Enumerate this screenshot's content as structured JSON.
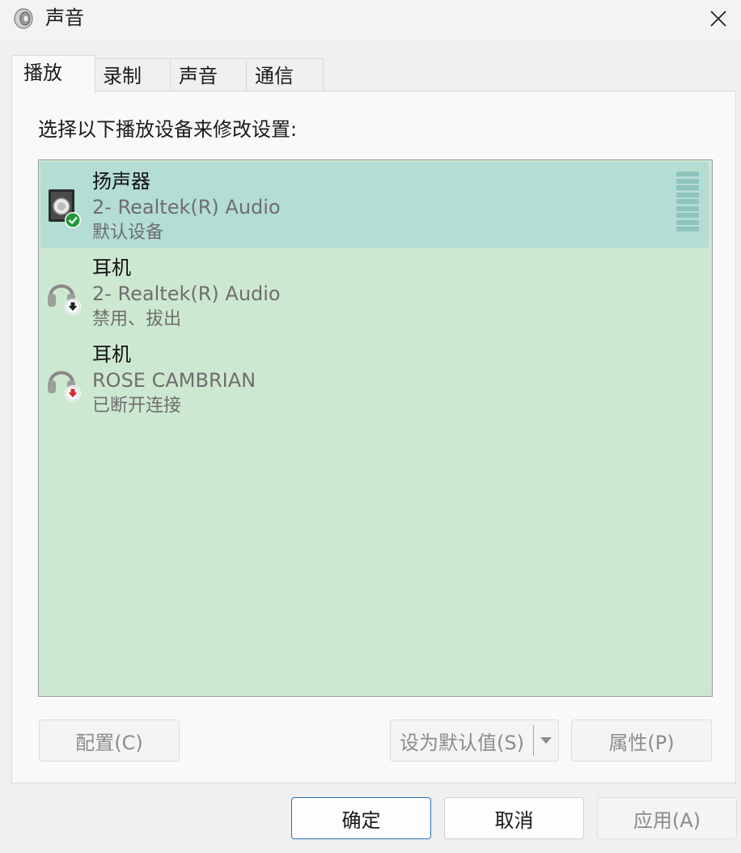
{
  "window": {
    "title": "声音",
    "icon": "speaker-icon",
    "close_icon": "close-icon"
  },
  "tabs": [
    {
      "label": "播放",
      "active": true
    },
    {
      "label": "录制",
      "active": false
    },
    {
      "label": "声音",
      "active": false
    },
    {
      "label": "通信",
      "active": false
    }
  ],
  "playback": {
    "instruction": "选择以下播放设备来修改设置:",
    "devices": [
      {
        "name": "扬声器",
        "description": "2- Realtek(R) Audio",
        "status": "默认设备",
        "icon": "speaker-device-icon",
        "badge": "check-badge-icon",
        "selected": true
      },
      {
        "name": "耳机",
        "description": "2- Realtek(R) Audio",
        "status": "禁用、拔出",
        "icon": "headphones-icon",
        "badge": "down-arrow-badge-icon",
        "selected": false
      },
      {
        "name": "耳机",
        "description": "ROSE CAMBRIAN",
        "status": "已断开连接",
        "icon": "headphones-icon",
        "badge": "red-down-arrow-badge-icon",
        "selected": false
      }
    ],
    "buttons": {
      "configure": "配置(C)",
      "set_default": "设为默认值(S)",
      "properties": "属性(P)"
    }
  },
  "footer": {
    "ok": "确定",
    "cancel": "取消",
    "apply": "应用(A)"
  },
  "colors": {
    "list_bg": "#cde8d0",
    "selected_bg": "#b4ddd4",
    "check_badge": "#1e9a3a",
    "red_badge": "#d8272e"
  }
}
